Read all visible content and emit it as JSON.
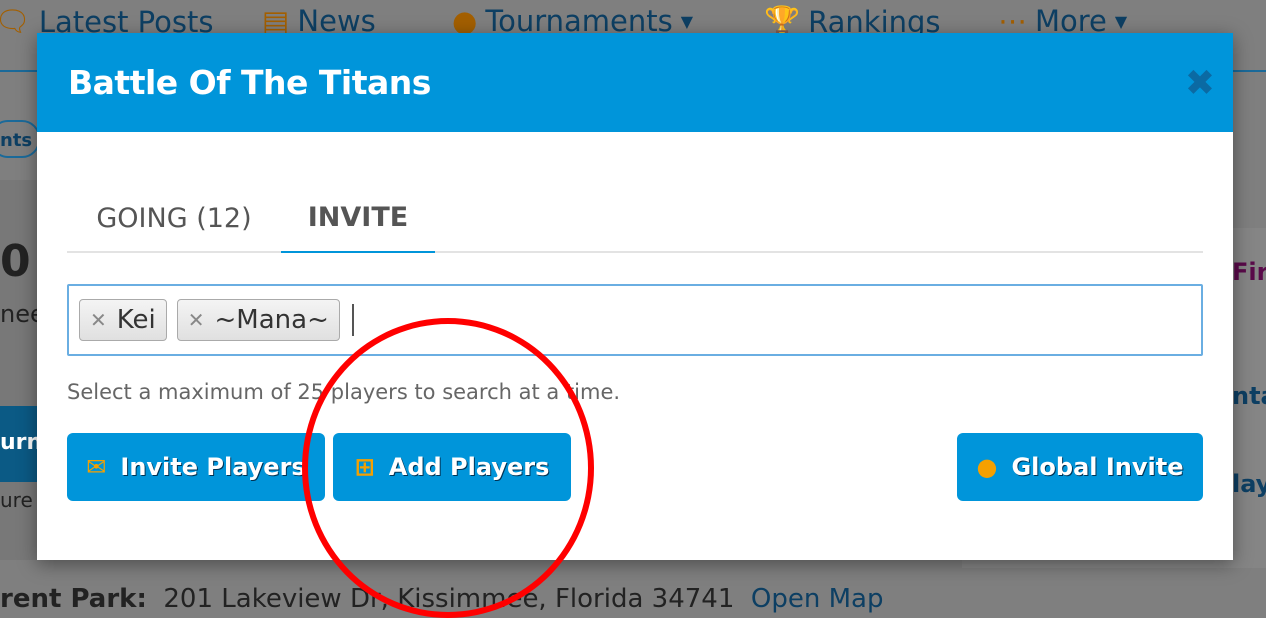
{
  "nav": [
    {
      "label": "Latest Posts",
      "icon": "chat-icon"
    },
    {
      "label": "News",
      "icon": "newspaper-icon"
    },
    {
      "label": "Tournaments",
      "icon": "globe-icon",
      "dropdown": true
    },
    {
      "label": "Rankings",
      "icon": "trophy-icon"
    },
    {
      "label": "More",
      "icon": "dots-icon",
      "dropdown": true
    }
  ],
  "background": {
    "pill": "nts",
    "heading": "0",
    "side_text_1": "nee",
    "tab": "urn",
    "side_text_2": "ure",
    "right_heading": "Fir",
    "right_link_1": "nta",
    "right_link_2": "lay",
    "address_label": "rent Park:",
    "address": "201 Lakeview Dr, Kissimmee, Florida 34741",
    "map_link": "Open Map"
  },
  "modal": {
    "title": "Battle Of The Titans",
    "tabs": [
      {
        "label": "GOING (12)",
        "active": false
      },
      {
        "label": "INVITE",
        "active": true
      }
    ],
    "tags": [
      "Kei",
      "~Mana~"
    ],
    "help_text": "Select a maximum of 25 players to search at a time.",
    "buttons": {
      "invite": "Invite Players",
      "add": "Add Players",
      "global": "Global Invite"
    }
  },
  "colors": {
    "primary": "#0095da",
    "icon_accent": "#f5a000",
    "annotation": "#ff0000"
  }
}
